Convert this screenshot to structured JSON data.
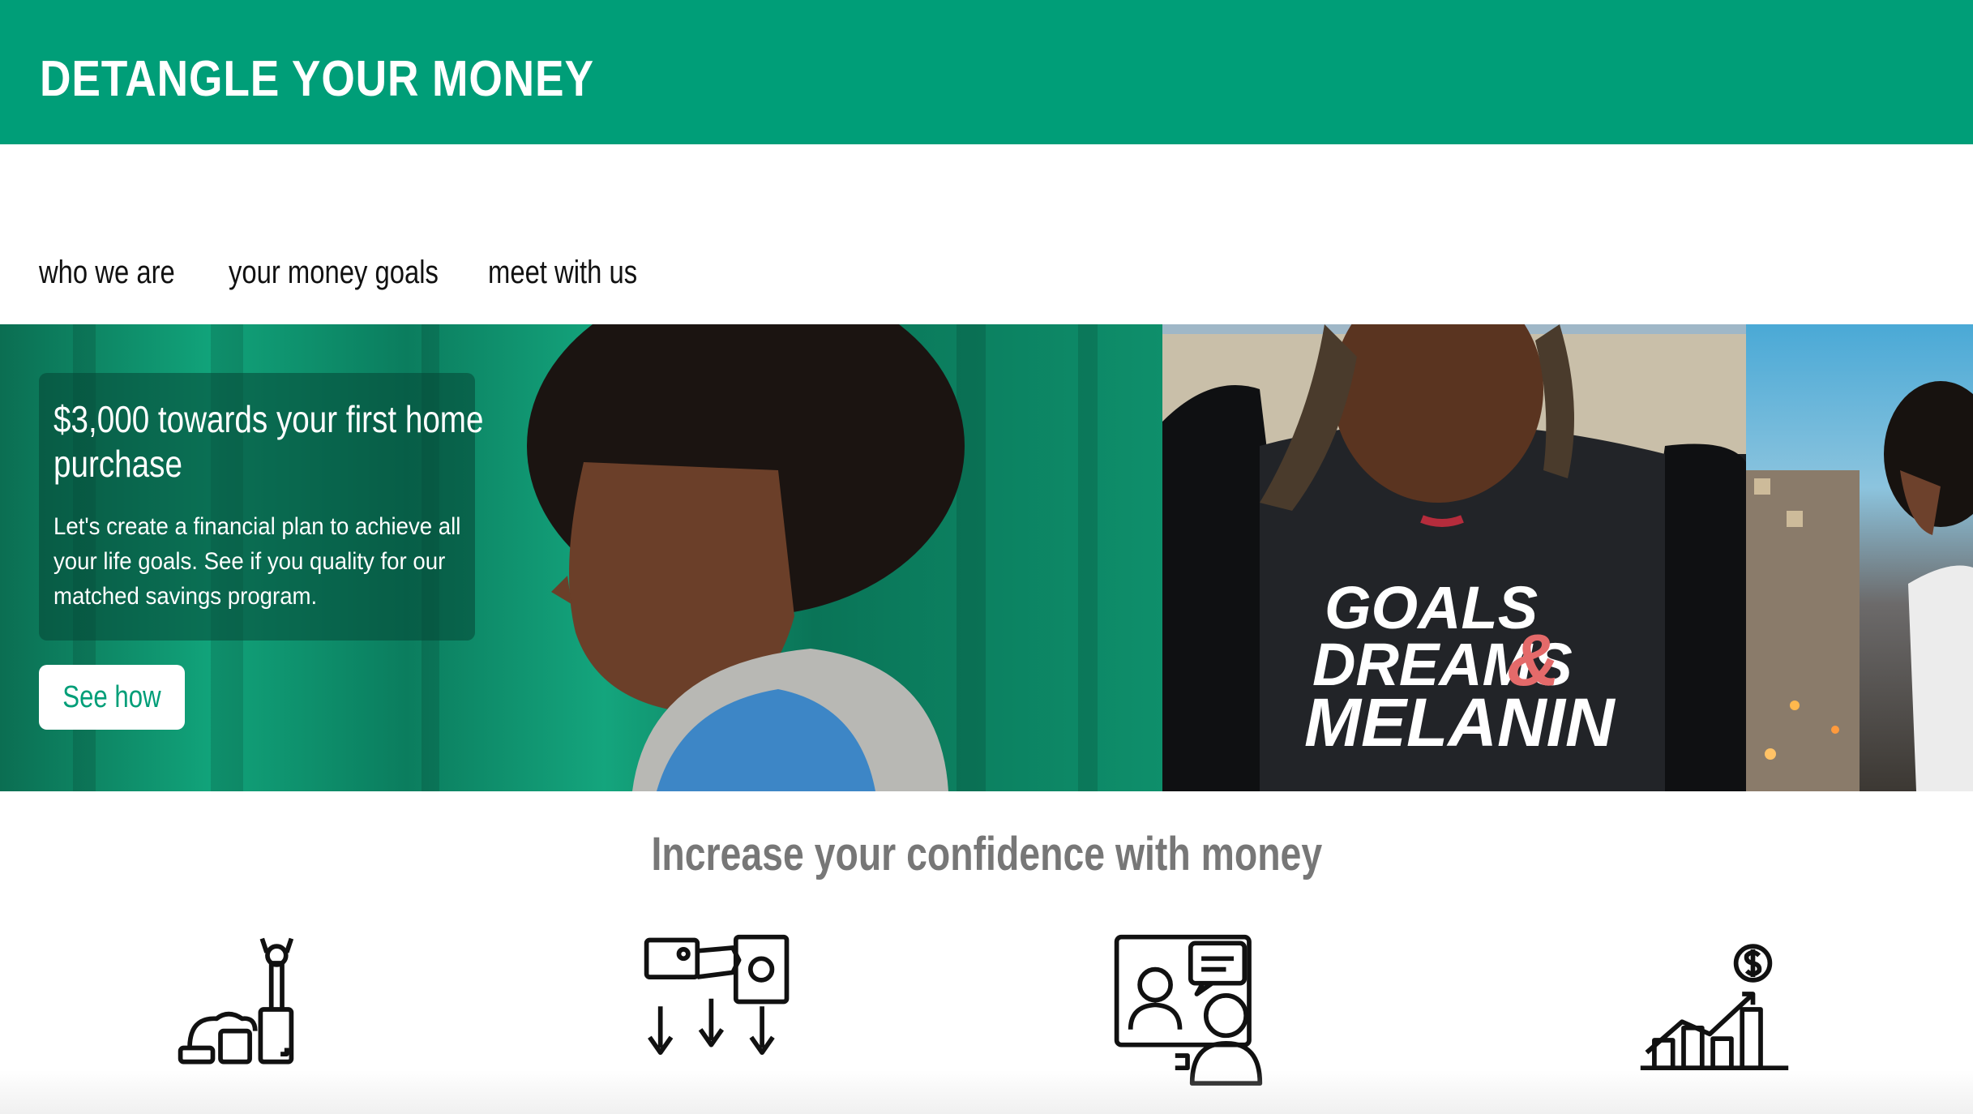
{
  "header": {
    "brand": "DETANGLE YOUR MONEY",
    "brand_color": "#009e78"
  },
  "nav": {
    "items": [
      {
        "label": "who we are"
      },
      {
        "label": "your money goals"
      },
      {
        "label": "meet with us"
      }
    ]
  },
  "hero": {
    "title": "$3,000 towards your first home purchase",
    "text": "Let's create a financial plan to achieve all your life goals. See if you quality for our matched savings program.",
    "button_label": "See how",
    "shirt_text": [
      "GOALS",
      "DREAMS",
      "&",
      "MELANIN"
    ]
  },
  "section": {
    "tagline": "Increase your confidence with money"
  },
  "features": [
    {
      "icon": "achievement-steps-icon"
    },
    {
      "icon": "payment-money-down-icon"
    },
    {
      "icon": "video-consultation-icon"
    },
    {
      "icon": "growth-chart-dollar-icon"
    }
  ]
}
